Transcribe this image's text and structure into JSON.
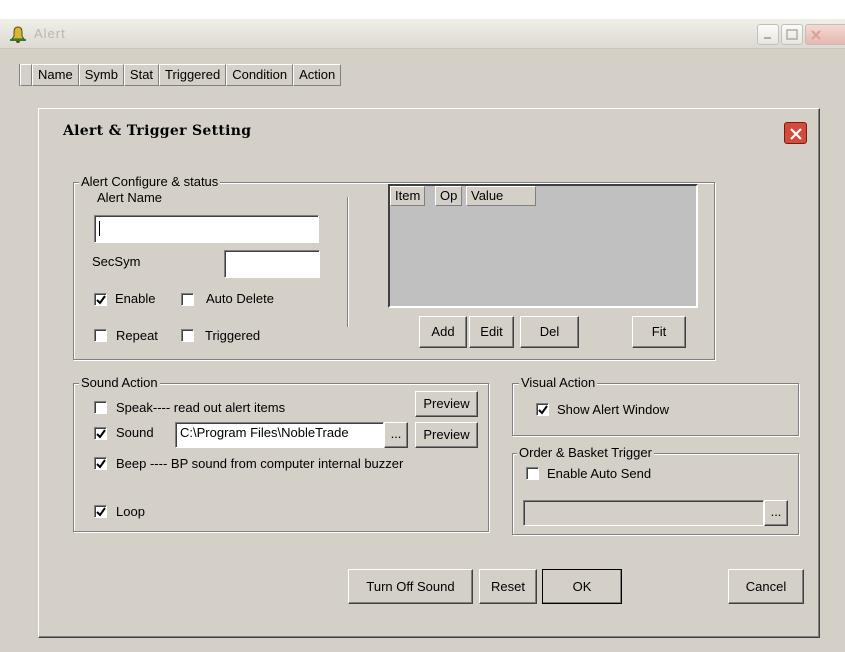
{
  "outer_window": {
    "title": "Alert",
    "columns": [
      "Name",
      "Symb",
      "Stat",
      "Triggered",
      "Condition",
      "Action"
    ]
  },
  "dialog": {
    "title": "Alert & Trigger Setting",
    "alert_group": {
      "legend": "Alert Configure & status",
      "alert_name_label": "Alert Name",
      "alert_name_value": "",
      "secsym_label": "SecSym",
      "secsym_value": "",
      "enable_label": "Enable",
      "enable_checked": true,
      "auto_delete_label": "Auto Delete",
      "auto_delete_checked": false,
      "repeat_label": "Repeat",
      "repeat_checked": false,
      "triggered_label": "Triggered",
      "triggered_checked": false,
      "list_columns": [
        "Item",
        "Op",
        "Value"
      ],
      "add_label": "Add",
      "edit_label": "Edit",
      "del_label": "Del",
      "fit_label": "Fit"
    },
    "sound_group": {
      "legend": "Sound Action",
      "speak_label": "Speak---- read out alert items",
      "speak_checked": false,
      "preview_label": "Preview",
      "sound_label": "Sound",
      "sound_checked": true,
      "sound_path": "C:\\Program Files\\NobleTrade",
      "browse_label": "...",
      "beep_label": "Beep ---- BP sound from computer  internal buzzer",
      "beep_checked": true,
      "loop_label": "Loop",
      "loop_checked": true
    },
    "visual_group": {
      "legend": "Visual Action",
      "show_alert_label": "Show Alert Window",
      "show_alert_checked": true
    },
    "order_group": {
      "legend": "Order & Basket Trigger",
      "auto_send_label": "Enable  Auto Send",
      "auto_send_checked": false,
      "browse_label": "..."
    },
    "buttons": {
      "turn_off_sound": "Turn Off Sound",
      "reset": "Reset",
      "ok": "OK",
      "cancel": "Cancel"
    }
  }
}
